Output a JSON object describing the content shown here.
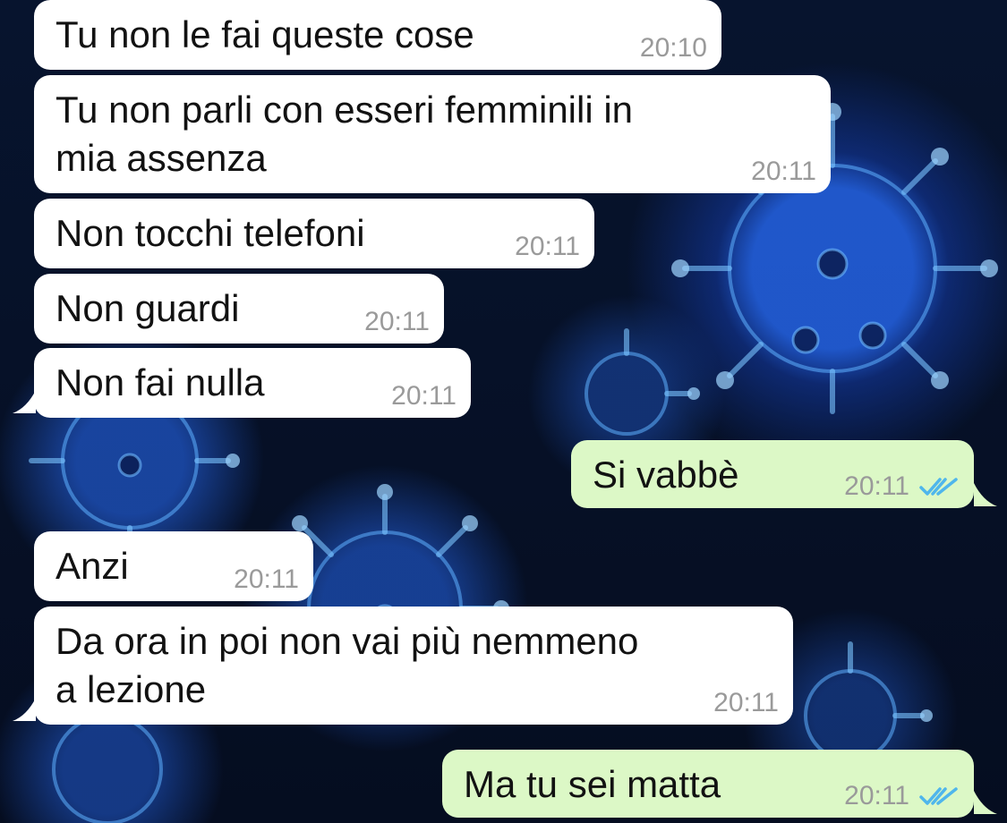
{
  "messages": [
    {
      "direction": "incoming",
      "text": "Tu non le fai queste cose",
      "time": "20:10"
    },
    {
      "direction": "incoming",
      "text": "Tu non parli con esseri femminili in\nmia assenza",
      "time": "20:11"
    },
    {
      "direction": "incoming",
      "text": "Non tocchi telefoni",
      "time": "20:11"
    },
    {
      "direction": "incoming",
      "text": "Non guardi",
      "time": "20:11"
    },
    {
      "direction": "incoming",
      "text": "Non fai nulla",
      "time": "20:11"
    },
    {
      "direction": "outgoing",
      "text": "Si vabbè",
      "time": "20:11",
      "status": "read"
    },
    {
      "direction": "incoming",
      "text": "Anzi",
      "time": "20:11"
    },
    {
      "direction": "incoming",
      "text": "Da ora in poi non vai più nemmeno\na lezione",
      "time": "20:11"
    },
    {
      "direction": "outgoing",
      "text": "Ma tu sei matta",
      "time": "20:11",
      "status": "read"
    }
  ],
  "colors": {
    "incoming_bubble": "#ffffff",
    "outgoing_bubble": "#dcf8c6",
    "read_ticks": "#4fb6ec",
    "timestamp": "#9a9a9a",
    "wallpaper": "#061024"
  },
  "icons": {
    "read_receipt": "double-check-icon",
    "wallpaper": "virus-wallpaper"
  }
}
